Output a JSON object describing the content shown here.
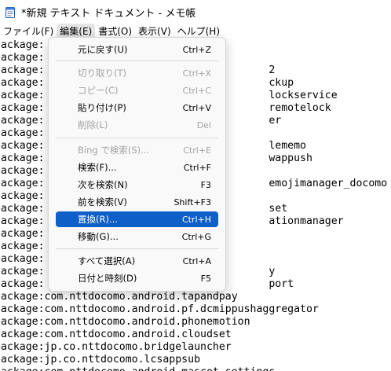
{
  "window": {
    "title": "*新規 テキスト ドキュメント - メモ帳"
  },
  "menubar": {
    "items": [
      "ファイル(F)",
      "編集(E)",
      "書式(O)",
      "表示(V)",
      "ヘルプ(H)"
    ]
  },
  "editor": {
    "lines": [
      "package:",
      "package:",
      "package:                                    2",
      "package:                                    ckup",
      "package:                                    lockservice",
      "package:                                    remotelock",
      "package:                                    er",
      "package:",
      "package:                                    lememo",
      "package:                                    wappush",
      "package:",
      "package:                                    emojimanager_docomo",
      "package:",
      "package:                                    set",
      "package:                                    ationmanager",
      "package:",
      "package:",
      "package:",
      "package:                                    y",
      "package:                                    port",
      "package:com.nttdocomo.android.tapandpay",
      "package:com.nttdocomo.android.pf.dcmippushaggregator",
      "package:com.nttdocomo.android.phonemotion",
      "package:com.nttdocomo.android.cloudset",
      "package:jp.co.nttdocomo.bridgelauncher",
      "package:jp.co.nttdocomo.lcsappsub",
      "package:com.nttdocomo.android.mascot.settings"
    ]
  },
  "edit_menu": {
    "items": [
      {
        "label": "元に戻す(U)",
        "shortcut": "Ctrl+Z",
        "disabled": false
      },
      {
        "label": "切り取り(T)",
        "shortcut": "Ctrl+X",
        "disabled": true
      },
      {
        "label": "コピー(C)",
        "shortcut": "Ctrl+C",
        "disabled": true
      },
      {
        "label": "貼り付け(P)",
        "shortcut": "Ctrl+V",
        "disabled": false
      },
      {
        "label": "削除(L)",
        "shortcut": "Del",
        "disabled": true
      },
      {
        "label": "Bing で検索(S)...",
        "shortcut": "Ctrl+E",
        "disabled": true
      },
      {
        "label": "検索(F)...",
        "shortcut": "Ctrl+F",
        "disabled": false
      },
      {
        "label": "次を検索(N)",
        "shortcut": "F3",
        "disabled": false
      },
      {
        "label": "前を検索(V)",
        "shortcut": "Shift+F3",
        "disabled": false
      },
      {
        "label": "置換(R)...",
        "shortcut": "Ctrl+H",
        "disabled": false,
        "selected": true
      },
      {
        "label": "移動(G)...",
        "shortcut": "Ctrl+G",
        "disabled": false
      },
      {
        "label": "すべて選択(A)",
        "shortcut": "Ctrl+A",
        "disabled": false
      },
      {
        "label": "日付と時刻(D)",
        "shortcut": "F5",
        "disabled": false
      }
    ]
  },
  "colors": {
    "selection": "#0f5fc8",
    "disabled_text": "#a3a3a3",
    "menu_bg": "#f9f9f9"
  }
}
